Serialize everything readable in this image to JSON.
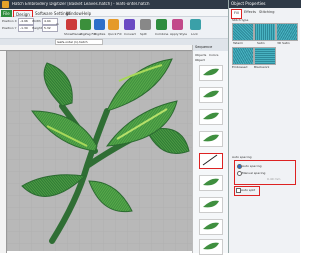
{
  "window": {
    "title": "Hatch Embroidery Digitizer [Basket Leaves.hatch] - leafs-ontel.hatch"
  },
  "menu": [
    "File",
    "Design",
    "Software Settings",
    "Window",
    "Help"
  ],
  "toolbar": {
    "position_x_label": "Position X",
    "position_y_label": "Position Y",
    "width_label": "Width",
    "height_label": "Height",
    "position_x": "-4.96",
    "position_y": "-1.30",
    "width": "4.94",
    "height": "5.32",
    "unit": "in",
    "buttons": [
      "ShowPlaces",
      "ZigZag Fill",
      "Digitize",
      "Quick Fill",
      "Convert",
      "Split",
      "Combine",
      "Apply Style",
      "Lock"
    ]
  },
  "document_tab": "leafs-ontel (1).hatch",
  "sequence": {
    "title": "Sequence",
    "tabs": [
      "Objects",
      "Colors"
    ],
    "header": "Object",
    "item_count": 9,
    "selected_index": 4
  },
  "properties": {
    "title": "Object Properties",
    "tabs": [
      "Fill",
      "Effects",
      "Stitching"
    ],
    "section_label": "Stitch type",
    "swatches": [
      "Tatami",
      "Satin",
      "3D Satin",
      "Embossed",
      "Blackwork"
    ],
    "spacing_group": "Auto spacing",
    "auto_spacing": "Auto spacing",
    "manual_spacing": "Manual spacing",
    "auto_split": "Auto split",
    "manual_value": "0.40 mm",
    "auto_spacing_checked": true,
    "auto_split_checked": false
  },
  "colors": {
    "accent_green": "#2e8d3f",
    "highlight_red": "#dd2222",
    "leaf_green": "#3b8f3b"
  }
}
